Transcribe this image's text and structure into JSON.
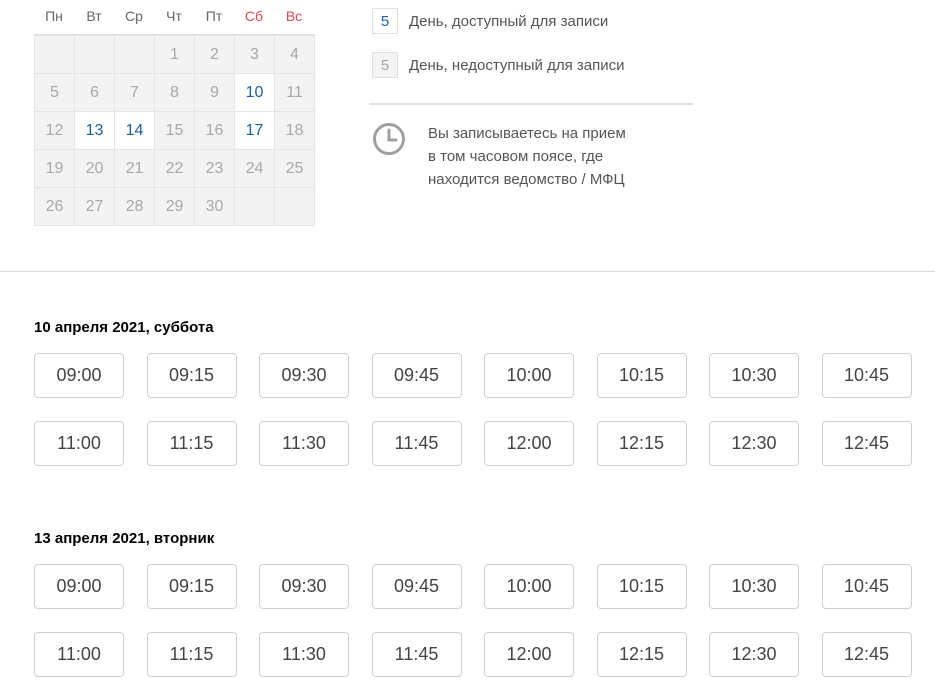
{
  "calendar": {
    "weekdays": [
      {
        "label": "Пн",
        "weekend": false
      },
      {
        "label": "Вт",
        "weekend": false
      },
      {
        "label": "Ср",
        "weekend": false
      },
      {
        "label": "Чт",
        "weekend": false
      },
      {
        "label": "Пт",
        "weekend": false
      },
      {
        "label": "Сб",
        "weekend": true
      },
      {
        "label": "Вс",
        "weekend": true
      }
    ],
    "cells": [
      {
        "day": "",
        "available": false
      },
      {
        "day": "",
        "available": false
      },
      {
        "day": "",
        "available": false
      },
      {
        "day": "1",
        "available": false
      },
      {
        "day": "2",
        "available": false
      },
      {
        "day": "3",
        "available": false
      },
      {
        "day": "4",
        "available": false
      },
      {
        "day": "5",
        "available": false
      },
      {
        "day": "6",
        "available": false
      },
      {
        "day": "7",
        "available": false
      },
      {
        "day": "8",
        "available": false
      },
      {
        "day": "9",
        "available": false
      },
      {
        "day": "10",
        "available": true
      },
      {
        "day": "11",
        "available": false
      },
      {
        "day": "12",
        "available": false
      },
      {
        "day": "13",
        "available": true
      },
      {
        "day": "14",
        "available": true
      },
      {
        "day": "15",
        "available": false
      },
      {
        "day": "16",
        "available": false
      },
      {
        "day": "17",
        "available": true
      },
      {
        "day": "18",
        "available": false
      },
      {
        "day": "19",
        "available": false
      },
      {
        "day": "20",
        "available": false
      },
      {
        "day": "21",
        "available": false
      },
      {
        "day": "22",
        "available": false
      },
      {
        "day": "23",
        "available": false
      },
      {
        "day": "24",
        "available": false
      },
      {
        "day": "25",
        "available": false
      },
      {
        "day": "26",
        "available": false
      },
      {
        "day": "27",
        "available": false
      },
      {
        "day": "28",
        "available": false
      },
      {
        "day": "29",
        "available": false
      },
      {
        "day": "30",
        "available": false
      },
      {
        "day": "",
        "available": false
      },
      {
        "day": "",
        "available": false
      }
    ]
  },
  "legend": {
    "available": {
      "sample": "5",
      "label": "День, доступный для записи"
    },
    "unavailable": {
      "sample": "5",
      "label": "День, недоступный для записи"
    }
  },
  "timezone": {
    "icon": "clock-icon",
    "lines": [
      "Вы записываетесь на прием",
      "в том часовом поясе, где",
      "находится ведомство / МФЦ"
    ]
  },
  "days": [
    {
      "title": "10 апреля 2021, суббота",
      "slots": [
        "09:00",
        "09:15",
        "09:30",
        "09:45",
        "10:00",
        "10:15",
        "10:30",
        "10:45",
        "11:00",
        "11:15",
        "11:30",
        "11:45",
        "12:00",
        "12:15",
        "12:30",
        "12:45"
      ]
    },
    {
      "title": "13 апреля 2021, вторник",
      "slots": [
        "09:00",
        "09:15",
        "09:30",
        "09:45",
        "10:00",
        "10:15",
        "10:30",
        "10:45",
        "11:00",
        "11:15",
        "11:30",
        "11:45",
        "12:00",
        "12:15",
        "12:30",
        "12:45"
      ]
    }
  ],
  "colors": {
    "accent": "#1a5fa8",
    "weekend": "#e0474c",
    "unavailable_bg": "#f3f3f3"
  }
}
